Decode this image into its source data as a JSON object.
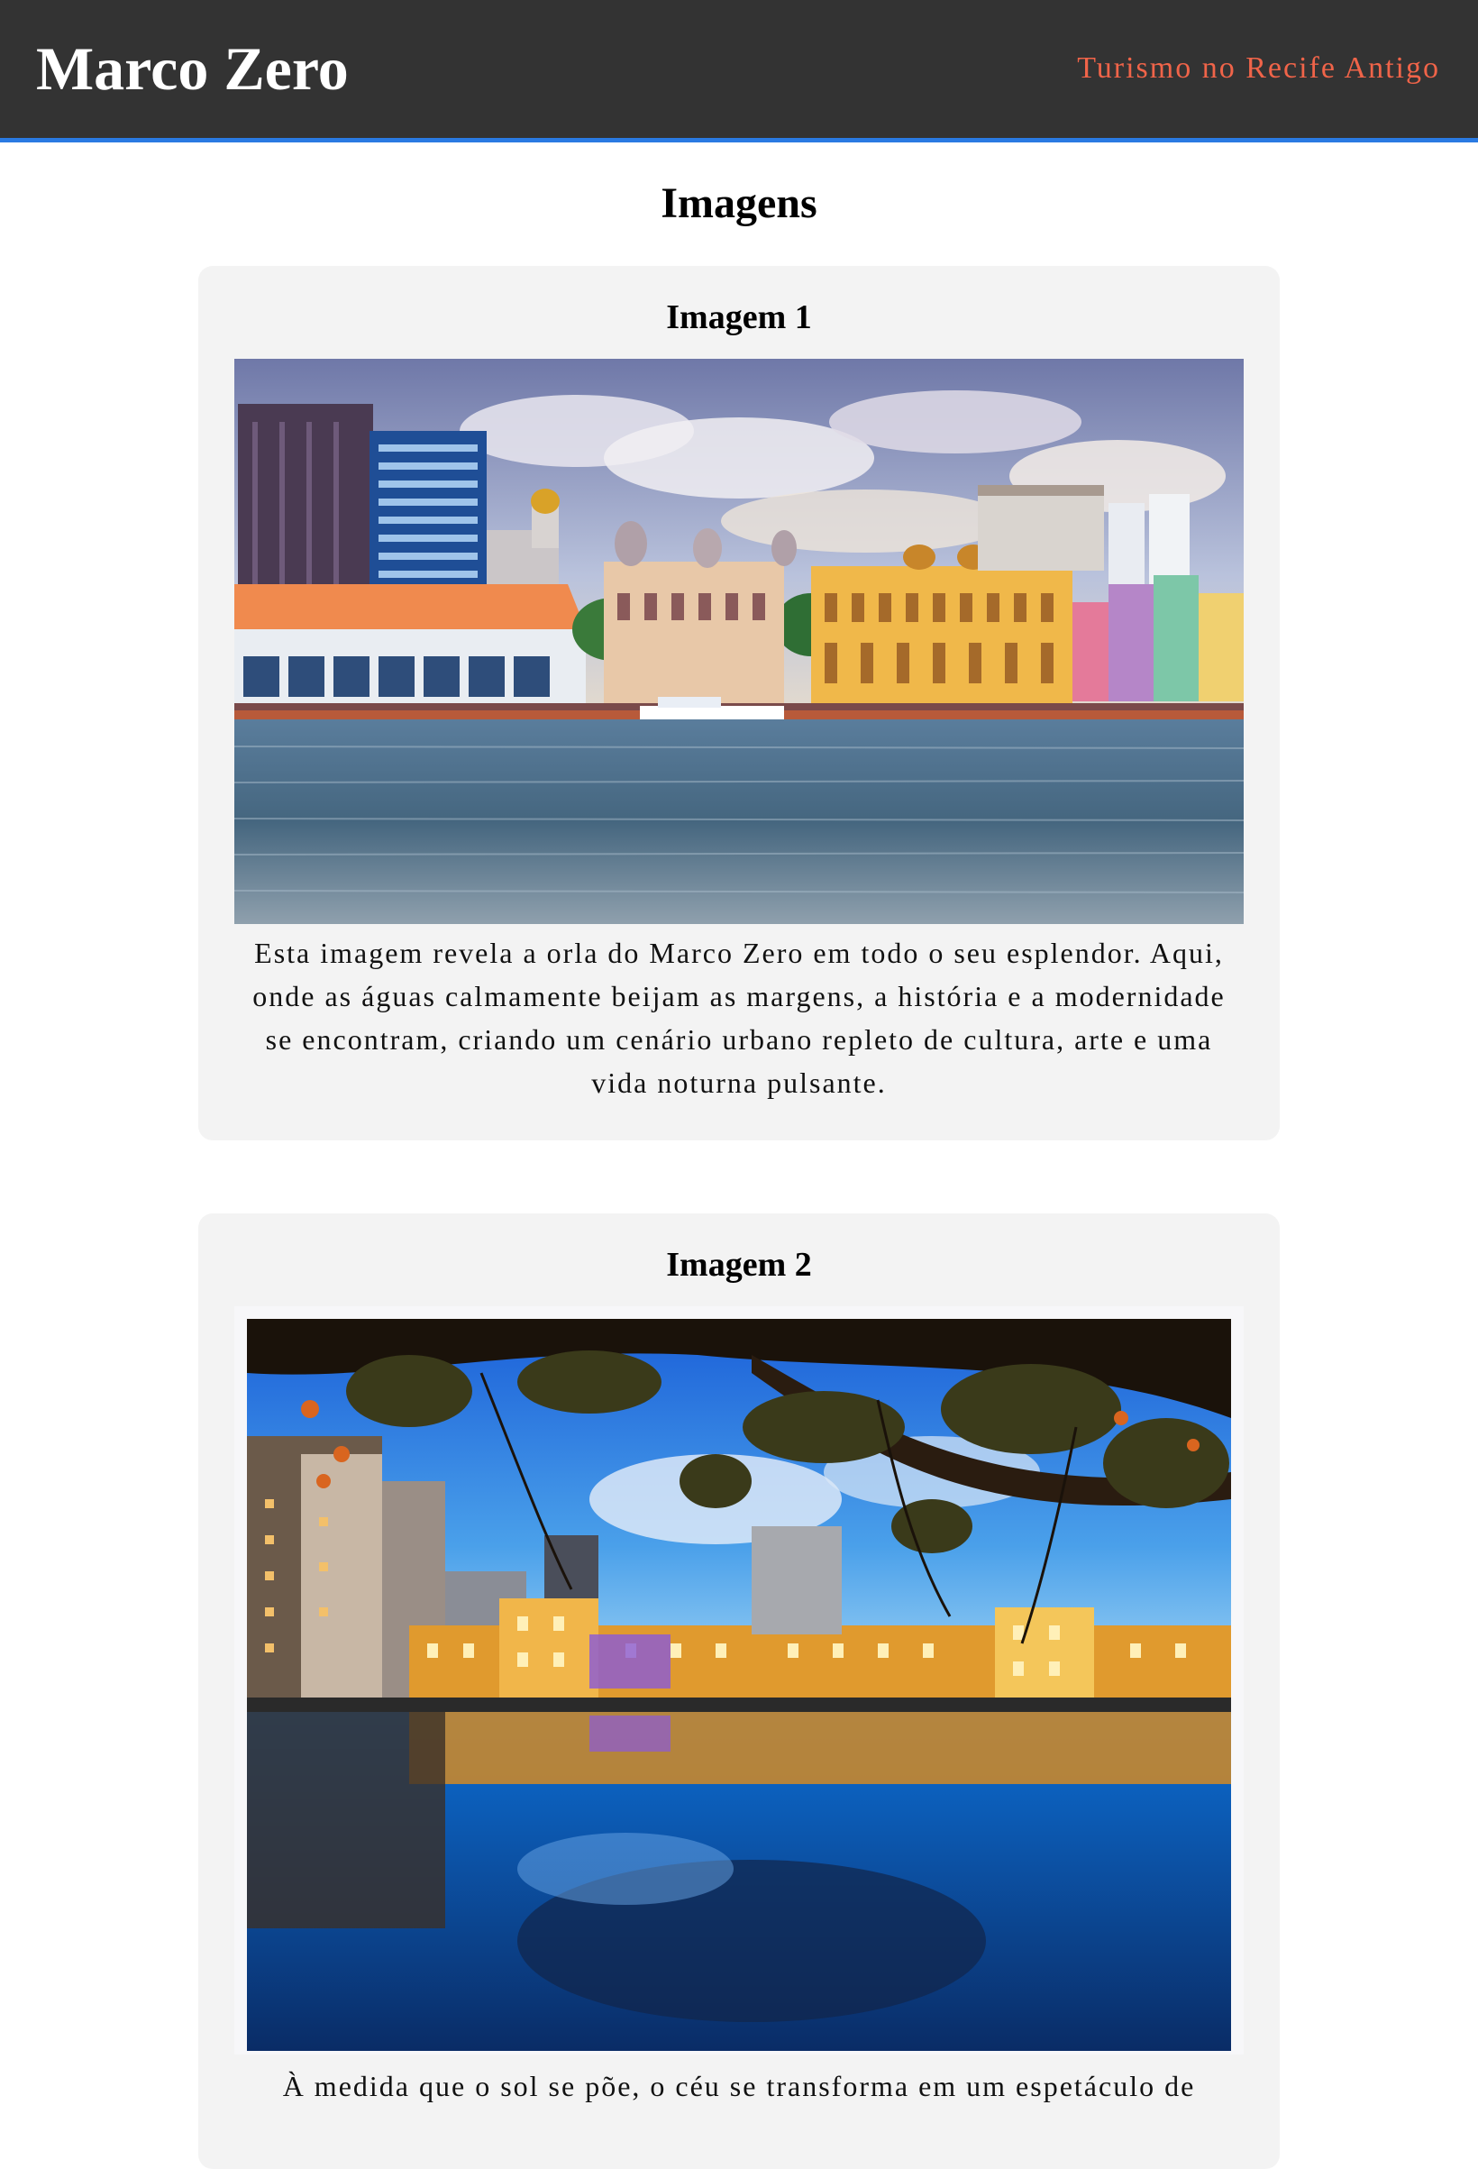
{
  "header": {
    "title": "Marco Zero",
    "subtitle": "Turismo no Recife Antigo"
  },
  "main": {
    "heading": "Imagens",
    "cards": [
      {
        "title": "Imagem 1",
        "caption": "Esta imagem revela a orla do Marco Zero em todo o seu esplendor. Aqui, onde as águas calmamente beijam as margens, a história e a modernidade se encontram, criando um cenário urbano repleto de cultura, arte e uma vida noturna pulsante."
      },
      {
        "title": "Imagem 2",
        "caption": "À medida que o sol se põe, o céu se transforma em um espetáculo de"
      }
    ]
  },
  "colors": {
    "header_bg": "#333333",
    "header_accent": "#2a7ae2",
    "subtitle": "#f06449",
    "card_bg": "#f3f3f3"
  }
}
